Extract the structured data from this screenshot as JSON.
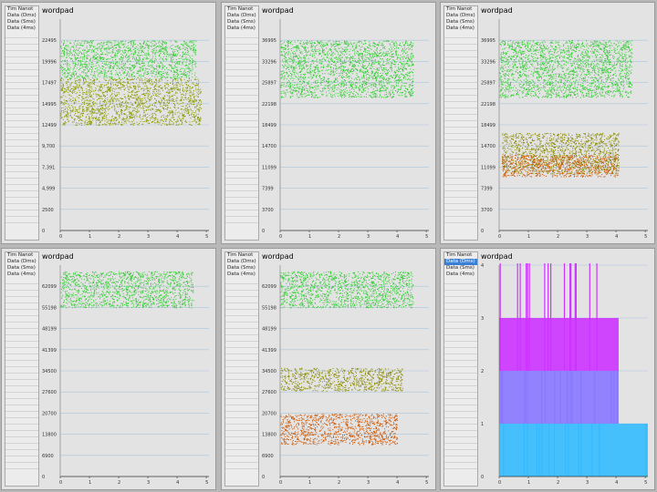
{
  "panels": [
    {
      "title": "wordpad",
      "legend": [
        "Tim Nanot",
        "Data (Dms)",
        "Data (Sms)",
        "Data (4ms)"
      ],
      "selected": -1,
      "chart_data": {
        "type": "scatter",
        "title": "wordpad",
        "xticks": [
          "0",
          "1",
          "2",
          "3",
          "4",
          "5"
        ],
        "yticks": [
          "0",
          "2500",
          "4,999",
          "7,391",
          "9,700",
          "12499",
          "14995",
          "17497",
          "19996",
          "22495"
        ],
        "series": [
          {
            "color": "#33cc33",
            "x_range": [
              0,
              5.1
            ],
            "y_range": [
              18000,
              22495
            ]
          },
          {
            "color": "#8a9a00",
            "x_range": [
              0,
              5.3
            ],
            "y_range": [
              12499,
              18000
            ]
          }
        ]
      }
    },
    {
      "title": "wordpad",
      "legend": [
        "Tim Nanot",
        "Data (Dms)",
        "Data (Sms)",
        "Data (4ms)"
      ],
      "selected": -1,
      "chart_data": {
        "type": "scatter",
        "title": "wordpad",
        "xticks": [
          "0",
          "1",
          "2",
          "3",
          "4",
          "5"
        ],
        "yticks": [
          "0",
          "3700",
          "7399",
          "11099",
          "14700",
          "18499",
          "22198",
          "25897",
          "33296",
          "36995"
        ],
        "series": [
          {
            "color": "#33cc33",
            "x_range": [
              0,
              5.0
            ],
            "y_range": [
              25897,
              36995
            ]
          }
        ]
      }
    },
    {
      "title": "wordpad",
      "legend": [
        "Tim Nanot",
        "Data (Dms)",
        "Data (Sms)",
        "Data (4ms)"
      ],
      "selected": -1,
      "chart_data": {
        "type": "scatter",
        "title": "wordpad",
        "xticks": [
          "0",
          "1",
          "2",
          "3",
          "4",
          "5"
        ],
        "yticks": [
          "0",
          "3700",
          "7399",
          "11099",
          "14700",
          "18499",
          "22198",
          "25897",
          "33296",
          "36995"
        ],
        "series": [
          {
            "color": "#33cc33",
            "x_range": [
              0,
              5.0
            ],
            "y_range": [
              25897,
              36995
            ]
          },
          {
            "color": "#8a8a00",
            "x_range": [
              0.1,
              4.5
            ],
            "y_range": [
              11099,
              19000
            ]
          },
          {
            "color": "#cc5500",
            "x_range": [
              0.1,
              4.5
            ],
            "y_range": [
              10500,
              14700
            ]
          }
        ]
      }
    },
    {
      "title": "wordpad",
      "legend": [
        "Tim Nanot",
        "Data (Dms)",
        "Data (Sms)",
        "Data (4ms)"
      ],
      "selected": -1,
      "chart_data": {
        "type": "scatter",
        "title": "wordpad",
        "xticks": [
          "0",
          "1",
          "2",
          "3",
          "4",
          "5"
        ],
        "yticks": [
          "0",
          "6900",
          "13800",
          "20700",
          "27600",
          "34500",
          "41399",
          "48199",
          "55198",
          "62099"
        ],
        "series": [
          {
            "color": "#33cc33",
            "x_range": [
              0,
              5.0
            ],
            "y_range": [
              55198,
              67000
            ]
          }
        ]
      }
    },
    {
      "title": "wordpad",
      "legend": [
        "Tim Nanot",
        "Data (Dms)",
        "Data (Sms)",
        "Data (4ms)"
      ],
      "selected": -1,
      "chart_data": {
        "type": "scatter",
        "title": "wordpad",
        "xticks": [
          "0",
          "1",
          "2",
          "3",
          "4",
          "5"
        ],
        "yticks": [
          "0",
          "6900",
          "13800",
          "20700",
          "27600",
          "34500",
          "41399",
          "48199",
          "55198",
          "62099"
        ],
        "series": [
          {
            "color": "#33cc33",
            "x_range": [
              0,
              5.0
            ],
            "y_range": [
              55198,
              67000
            ]
          },
          {
            "color": "#8a8a00",
            "x_range": [
              0,
              4.6
            ],
            "y_range": [
              28000,
              35500
            ]
          },
          {
            "color": "#cc5500",
            "x_range": [
              0,
              4.4
            ],
            "y_range": [
              10500,
              20500
            ]
          }
        ]
      }
    },
    {
      "title": "wordpad",
      "legend": [
        "Tim Nanot",
        "Data (Dms)",
        "Data (Sms)",
        "Data (4ms)"
      ],
      "selected": 1,
      "chart_data": {
        "type": "bar",
        "title": "wordpad",
        "xticks": [
          "0",
          "1",
          "2",
          "3",
          "4",
          "5"
        ],
        "yticks": [
          "0",
          "1",
          "2",
          "3",
          "4"
        ],
        "series": [
          {
            "color": "#cc33ff",
            "x_range": [
              0,
              4.5
            ],
            "level": 3
          },
          {
            "color": "#8877ff",
            "x_range": [
              0,
              4.5
            ],
            "level": 2
          },
          {
            "color": "#33bbff",
            "x_range": [
              0,
              5.6
            ],
            "level": 1
          }
        ]
      }
    }
  ]
}
